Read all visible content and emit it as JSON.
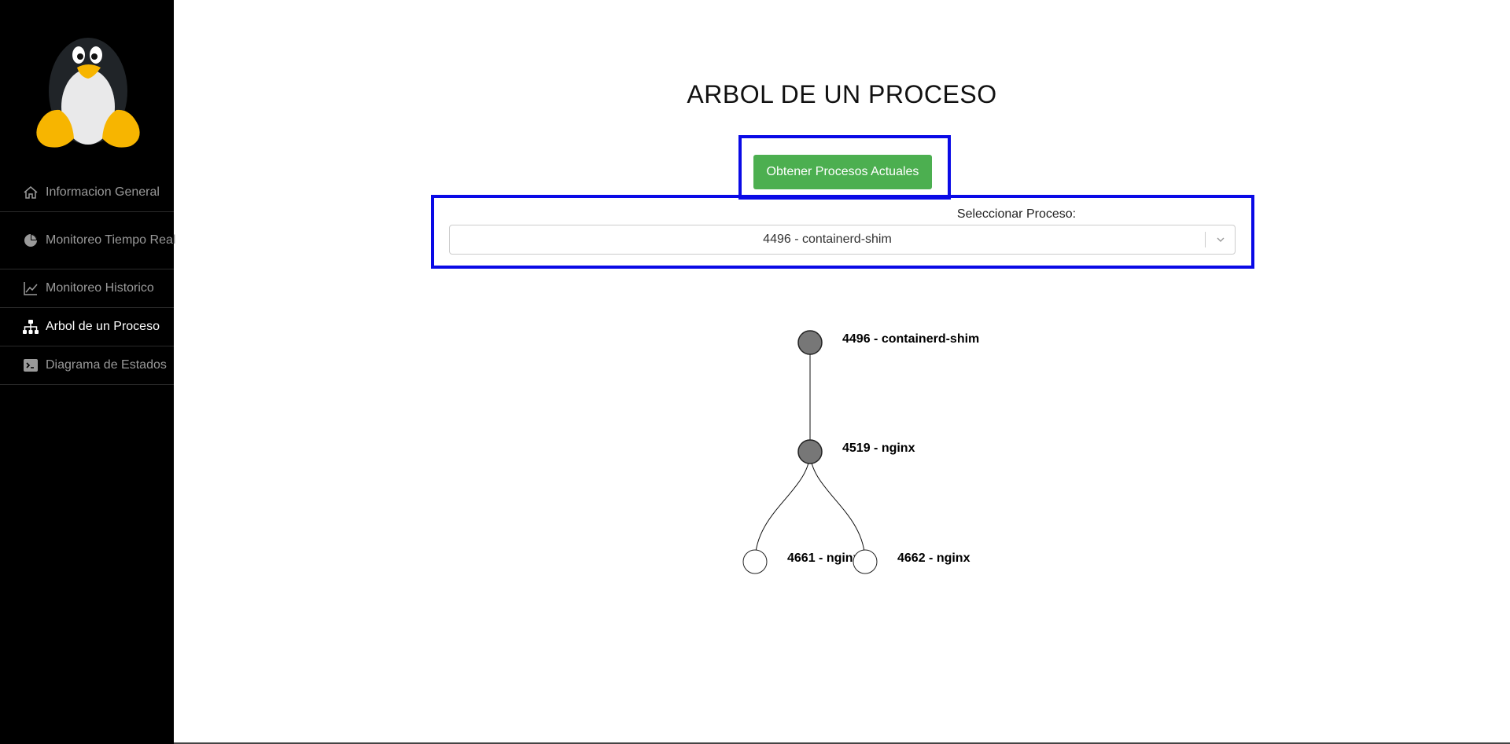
{
  "sidebar": {
    "logo": "linux-tux-penguin",
    "items": [
      {
        "label": "Informacion General",
        "icon": "home-icon",
        "active": false
      },
      {
        "label": "Monitoreo Tiempo Real",
        "icon": "pie-chart-icon",
        "active": false
      },
      {
        "label": "Monitoreo Historico",
        "icon": "line-chart-icon",
        "active": false
      },
      {
        "label": "Arbol de un Proceso",
        "icon": "sitemap-icon",
        "active": true
      },
      {
        "label": "Diagrama de Estados",
        "icon": "terminal-icon",
        "active": false
      }
    ]
  },
  "main": {
    "title": "ARBOL DE UN PROCESO",
    "fetch_button": "Obtener Procesos Actuales",
    "select_label": "Seleccionar Proceso:",
    "selected_process": "4496 - containerd-shim"
  },
  "tree": {
    "nodes": [
      {
        "label": "4496 - containerd-shim",
        "filled": true
      },
      {
        "label": "4519 - nginx",
        "filled": true
      },
      {
        "label": "4661 - nginx",
        "filled": false
      },
      {
        "label": "4662 - nginx",
        "filled": false
      }
    ],
    "colors": {
      "filled": "#777777",
      "empty": "#ffffff",
      "highlight": "#0a0ae6",
      "button": "#4caf50"
    }
  }
}
